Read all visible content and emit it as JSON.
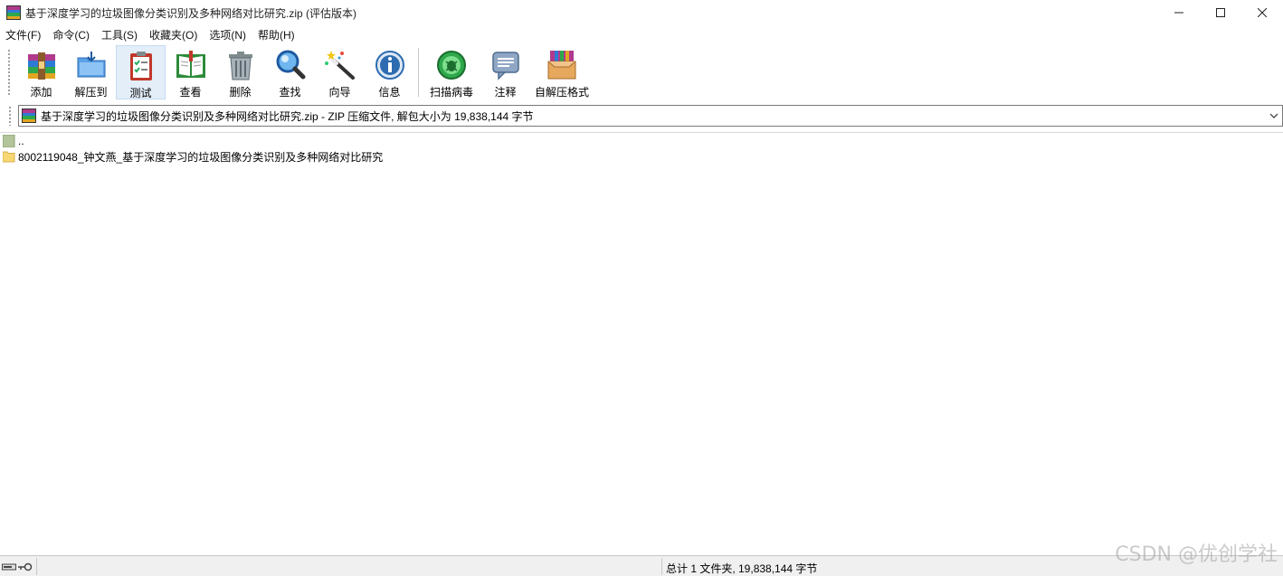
{
  "window": {
    "title": "基于深度学习的垃圾图像分类识别及多种网络对比研究.zip (评估版本)",
    "controls": [
      "minimize",
      "maximize",
      "close"
    ]
  },
  "menu": [
    {
      "label": "文件(F)"
    },
    {
      "label": "命令(C)"
    },
    {
      "label": "工具(S)"
    },
    {
      "label": "收藏夹(O)"
    },
    {
      "label": "选项(N)"
    },
    {
      "label": "帮助(H)"
    }
  ],
  "toolbar": {
    "add": "添加",
    "extract": "解压到",
    "test": "测试",
    "view": "查看",
    "delete": "删除",
    "find": "查找",
    "wizard": "向导",
    "info": "信息",
    "virus_scan": "扫描病毒",
    "comment": "注释",
    "sfx": "自解压格式",
    "active_tool": "test"
  },
  "address": {
    "text": "基于深度学习的垃圾图像分类识别及多种网络对比研究.zip - ZIP 压缩文件, 解包大小为 19,838,144 字节"
  },
  "files": [
    {
      "name": "..",
      "type": "parent-dir"
    },
    {
      "name": "8002119048_钟文燕_基于深度学习的垃圾图像分类识别及多种网络对比研究",
      "type": "folder"
    }
  ],
  "status": {
    "summary": "总计 1 文件夹, 19,838,144 字节"
  },
  "watermark": "CSDN @优创学社",
  "colors": {
    "accent_active": "#e3eef9",
    "folder": "#f7d774"
  }
}
